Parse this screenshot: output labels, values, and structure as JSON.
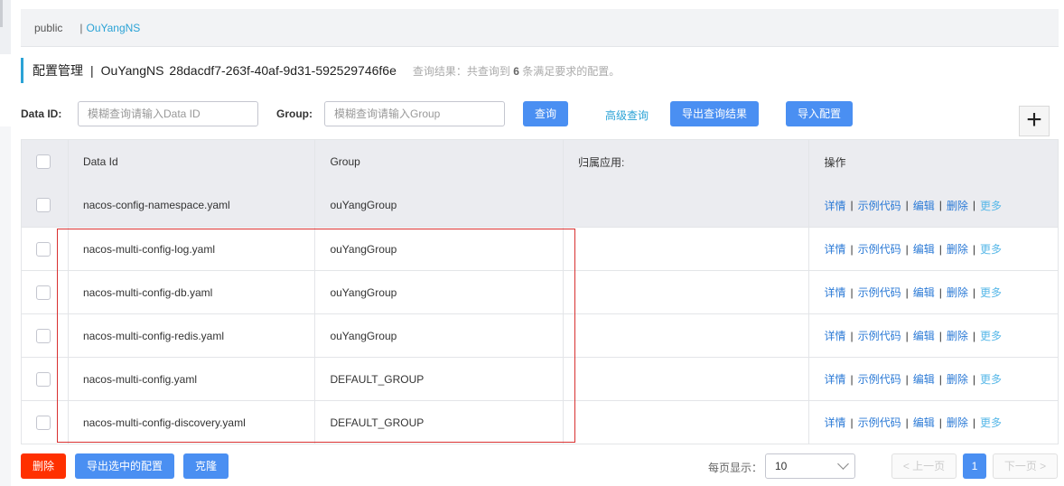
{
  "namespace_bar": {
    "items": [
      "public",
      "OuYangNS"
    ],
    "active": "OuYangNS"
  },
  "title": {
    "main": "配置管理",
    "separator": "|",
    "namespace": "OuYangNS",
    "namespace_id": "28dacdf7-263f-40af-9d31-592529746f6e",
    "result_prefix": "查询结果：共查询到",
    "result_count": "6",
    "result_suffix": "条满足要求的配置。"
  },
  "search": {
    "data_id_label": "Data ID:",
    "data_id_placeholder": "模糊查询请输入Data ID",
    "group_label": "Group:",
    "group_placeholder": "模糊查询请输入Group",
    "query_button": "查询",
    "advanced_link": "高级查询",
    "export_button": "导出查询结果",
    "import_button": "导入配置",
    "add_button": "+"
  },
  "table": {
    "headers": [
      "Data Id",
      "Group",
      "归属应用:",
      "操作"
    ],
    "rows": [
      {
        "data_id": "nacos-config-namespace.yaml",
        "group": "ouYangGroup",
        "app": ""
      },
      {
        "data_id": "nacos-multi-config-log.yaml",
        "group": "ouYangGroup",
        "app": ""
      },
      {
        "data_id": "nacos-multi-config-db.yaml",
        "group": "ouYangGroup",
        "app": ""
      },
      {
        "data_id": "nacos-multi-config-redis.yaml",
        "group": "ouYangGroup",
        "app": ""
      },
      {
        "data_id": "nacos-multi-config.yaml",
        "group": "DEFAULT_GROUP",
        "app": ""
      },
      {
        "data_id": "nacos-multi-config-discovery.yaml",
        "group": "DEFAULT_GROUP",
        "app": ""
      }
    ],
    "ops": {
      "detail": "详情",
      "sample": "示例代码",
      "edit": "编辑",
      "delete": "删除",
      "more": "更多",
      "sep": "|"
    }
  },
  "bottom": {
    "delete_button": "删除",
    "export_selected_button": "导出选中的配置",
    "clone_button": "克隆",
    "page_size_label": "每页显示：",
    "page_size_value": "10",
    "prev_button": "< 上一页",
    "current_page": "1",
    "next_button": "下一页 >"
  },
  "colors": {
    "primary": "#4a8ff2",
    "danger": "#ff3000",
    "link": "#2ba3d6",
    "highlight_box": "#d93030"
  }
}
